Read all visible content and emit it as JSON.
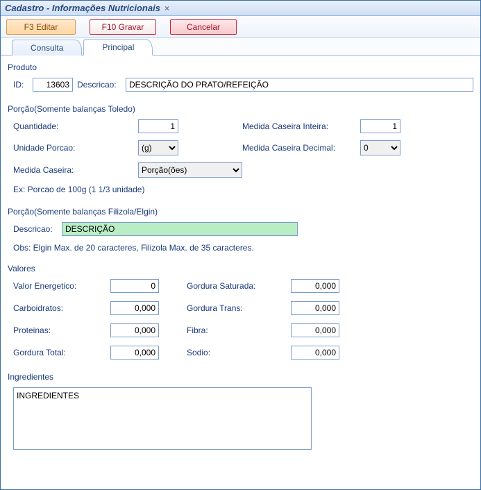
{
  "title": "Cadastro - Informações Nutricionais",
  "toolbar": {
    "edit": "F3 Editar",
    "save": "F10 Gravar",
    "cancel": "Cancelar"
  },
  "tabs": {
    "consulta": "Consulta",
    "principal": "Principal"
  },
  "produto": {
    "section": "Produto",
    "id_label": "ID:",
    "id_value": "13603",
    "descricao_label": "Descricao:",
    "descricao_value": "DESCRIÇÃO DO PRATO/REFEIÇÃO"
  },
  "porcao_toledo": {
    "section": "Porção(Somente balanças Toledo)",
    "quantidade_label": "Quantidade:",
    "quantidade_value": "1",
    "medida_inteira_label": "Medida Caseira Inteira:",
    "medida_inteira_value": "1",
    "unidade_label": "Unidade Porcao:",
    "unidade_value": "(g)",
    "medida_decimal_label": "Medida Caseira Decimal:",
    "medida_decimal_value": "0",
    "medida_caseira_label": "Medida Caseira:",
    "medida_caseira_value": "Porção(ões)",
    "ex": "Ex: Porcao de 100g (1 1/3 unidade)"
  },
  "porcao_filizola": {
    "section": "Porção(Somente balanças Filizola/Elgin)",
    "descricao_label": "Descricao:",
    "descricao_value": "DESCRIÇÃO",
    "obs": "Obs: Elgin Max. de 20 caracteres, Filizola Max. de 35 caracteres."
  },
  "valores": {
    "section": "Valores",
    "valor_energetico_label": "Valor Energetico:",
    "valor_energetico_value": "0",
    "gordura_saturada_label": "Gordura Saturada:",
    "gordura_saturada_value": "0,000",
    "carboidratos_label": "Carboidratos:",
    "carboidratos_value": "0,000",
    "gordura_trans_label": "Gordura Trans:",
    "gordura_trans_value": "0,000",
    "proteinas_label": "Proteinas:",
    "proteinas_value": "0,000",
    "fibra_label": "Fibra:",
    "fibra_value": "0,000",
    "gordura_total_label": "Gordura Total:",
    "gordura_total_value": "0,000",
    "sodio_label": "Sodio:",
    "sodio_value": "0,000"
  },
  "ingredientes": {
    "section": "Ingredientes",
    "value": "INGREDIENTES"
  }
}
